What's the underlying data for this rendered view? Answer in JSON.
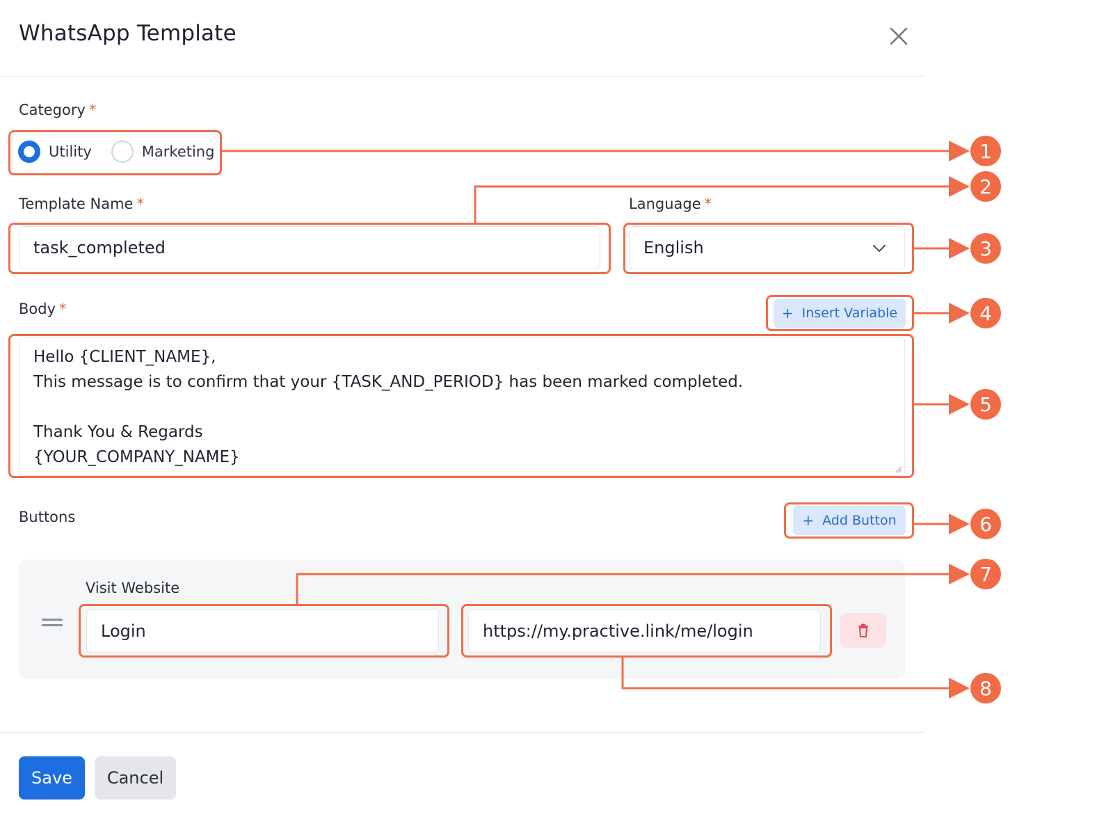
{
  "dialog": {
    "title": "WhatsApp Template",
    "close_icon": "close-icon"
  },
  "category": {
    "label": "Category",
    "required_mark": "*",
    "options": [
      {
        "label": "Utility",
        "selected": true
      },
      {
        "label": "Marketing",
        "selected": false
      }
    ]
  },
  "template_name": {
    "label": "Template Name",
    "required_mark": "*",
    "value": "task_completed"
  },
  "language": {
    "label": "Language",
    "required_mark": "*",
    "value": "English",
    "icon": "chevron-down-icon"
  },
  "body": {
    "label": "Body",
    "required_mark": "*",
    "insert_variable_label": "Insert Variable",
    "lines": [
      "Hello {CLIENT_NAME},",
      "This message is to confirm that your {TASK_AND_PERIOD} has been marked completed.",
      "",
      "Thank You & Regards",
      "{YOUR_COMPANY_NAME}"
    ]
  },
  "buttons": {
    "label": "Buttons",
    "add_button_label": "Add Button",
    "items": [
      {
        "type_label": "Visit Website",
        "text_value": "Login",
        "url_value": "https://my.practive.link/me/login",
        "delete_icon": "trash-icon",
        "drag_icon": "drag-handle-icon"
      }
    ]
  },
  "footer": {
    "save_label": "Save",
    "cancel_label": "Cancel"
  },
  "annotations": {
    "badges": [
      "1",
      "2",
      "3",
      "4",
      "5",
      "6",
      "7",
      "8"
    ],
    "color": "#ee6e4c"
  },
  "colors": {
    "primary": "#1d6fe0",
    "soft_button_bg": "#dbe8fb",
    "danger_soft_bg": "#fde3e6",
    "annotation": "#ee6e4c"
  }
}
